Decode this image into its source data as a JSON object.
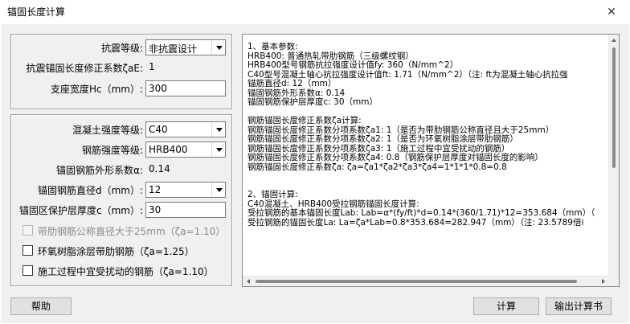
{
  "window": {
    "title": "锚固长度计算",
    "close_glyph": "✕"
  },
  "seismic": {
    "grade_label": "抗震等级:",
    "grade_value": "非抗震设计",
    "factor_label": "抗震锚固长度修正系数ζaE:",
    "factor_value": "1",
    "support_label": "支座宽度Hc（mm）:",
    "support_value": "300"
  },
  "params": {
    "concrete_label": "混凝土强度等级:",
    "concrete_value": "C40",
    "rebar_label": "钢筋强度等级:",
    "rebar_value": "HRB400",
    "shape_label": "锚固钢筋外形系数α:",
    "shape_value": "0.14",
    "diameter_label": "锚固钢筋直径d（mm）:",
    "diameter_value": "12",
    "cover_label": "锚固区保护层厚度c（mm）:",
    "cover_value": "30"
  },
  "checks": [
    {
      "label": "带肋钢筋公称直径大于25mm（ζa=1.10）",
      "checked": false,
      "disabled": true
    },
    {
      "label": "环氧树脂涂层带肋钢筋（ζa=1.25）",
      "checked": false,
      "disabled": false
    },
    {
      "label": "施工过程中宜受扰动的钢筋（ζa=1.10）",
      "checked": false,
      "disabled": false
    }
  ],
  "result_lines": [
    "1、基本参数:",
    "HRB400: 普通热轧带肋钢筋（三级螺纹钢）",
    "HRB400型号钢筋抗拉强度设计值fy: 360（N/mm^2）",
    "C40型号混凝土轴心抗拉强度设计值ft: 1.71（N/mm^2）（注: ft为混凝土轴心抗拉强",
    "锚筋直径d: 12（mm）",
    "锚固钢筋外形系数α: 0.14",
    "锚固钢筋保护层厚度c: 30（mm）",
    "",
    "钢筋锚固长度修正系数ζa计算:",
    "钢筋锚固长度修正系数分项系数ζa1: 1（是否为带肋钢筋公称直径且大于25mm）",
    "钢筋锚固长度修正系数分项系数ζa2: 1（是否为环氧树脂涂层带肋钢筋）",
    "钢筋锚固长度修正系数分项系数ζa3: 1（施工过程中宜受扰动的钢筋）",
    "钢筋锚固长度修正系数分项系数ζa4: 0.8（钢筋保护层厚度对锚固长度的影响）",
    "钢筋锚固长度修正系数ζa: ζa=ζa1*ζa2*ζa3*ζa4=1*1*1*0.8=0.8",
    "",
    "",
    "2、锚固计算:",
    "C40混凝土、HRB400受拉钢筋锚固长度计算:",
    "受拉钢筋的基本锚固长度Lab: Lab=α*(fy/ft)*d=0.14*(360/1.71)*12=353.684（mm）（",
    "受拉钢筋的锚固长度La: La=ζa*Lab=0.8*353.684=282.947（mm）（注: 23.5789倍ⅰ"
  ],
  "buttons": {
    "help": "帮助",
    "calc": "计算",
    "export": "输出计算书"
  }
}
